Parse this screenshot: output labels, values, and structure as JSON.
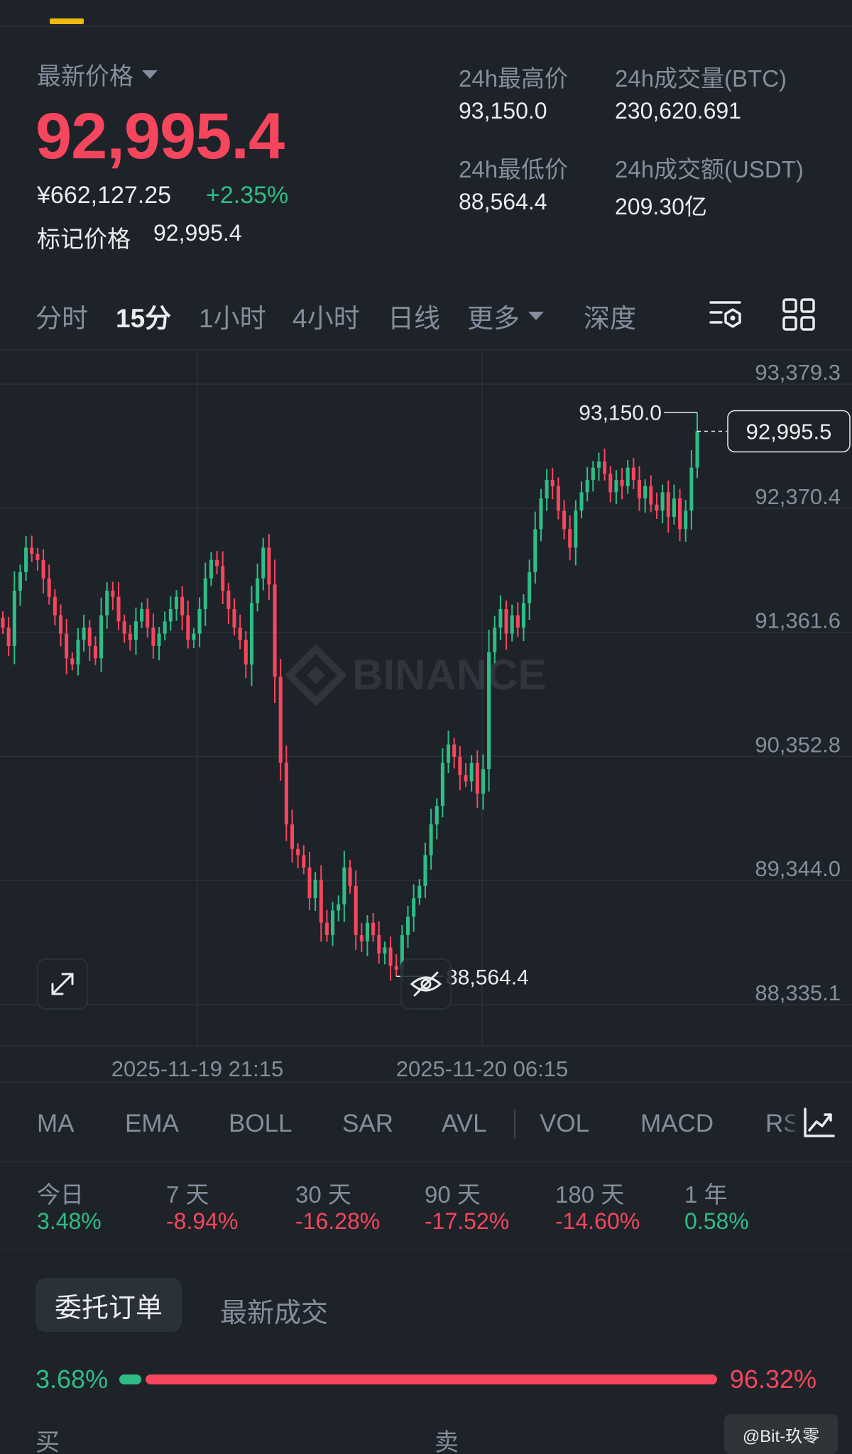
{
  "header": {
    "latest_label": "最新价格",
    "last_price": "92,995.4",
    "cny_price": "¥662,127.25",
    "change_pct": "+2.35%",
    "mark_label": "标记价格",
    "mark_value": "92,995.4"
  },
  "stats": {
    "high_label": "24h最高价",
    "high_value": "93,150.0",
    "low_label": "24h最低价",
    "low_value": "88,564.4",
    "vol_btc_label": "24h成交量(BTC)",
    "vol_btc_value": "230,620.691",
    "vol_usdt_label": "24h成交额(USDT)",
    "vol_usdt_value": "209.30亿"
  },
  "intervals": {
    "items": [
      "分时",
      "15分",
      "1小时",
      "4小时",
      "日线"
    ],
    "active": "15分",
    "more_label": "更多",
    "depth_label": "深度"
  },
  "chart": {
    "watermark": "BINANCE",
    "y_ticks": [
      "93,379.3",
      "92,370.4",
      "91,361.6",
      "90,352.8",
      "89,344.0",
      "88,335.1"
    ],
    "x_ticks": [
      "2025-11-19 21:15",
      "2025-11-20 06:15"
    ],
    "high_marker": "93,150.0",
    "low_marker": "88,564.4",
    "current_price_tag": "92,995.5",
    "up_color": "#2ebd85",
    "down_color": "#f6465d"
  },
  "chart_data": {
    "type": "candlestick",
    "interval": "15分",
    "y_ticks": [
      93379.3,
      92370.4,
      91361.6,
      90352.8,
      89344.0,
      88335.1
    ],
    "ylim": [
      88335.1,
      93379.3
    ],
    "x_ticks": [
      "2025-11-19 21:15",
      "2025-11-20 06:15"
    ],
    "high": 93150.0,
    "low": 88564.4,
    "last": 92995.5,
    "close_path": [
      91400,
      91250,
      91700,
      91850,
      92050,
      92000,
      91950,
      91800,
      91650,
      91500,
      91350,
      91150,
      91100,
      91300,
      91400,
      91250,
      91150,
      91500,
      91700,
      91650,
      91450,
      91350,
      91300,
      91450,
      91550,
      91400,
      91250,
      91350,
      91450,
      91550,
      91650,
      91500,
      91300,
      91350,
      91550,
      91800,
      91950,
      91900,
      91700,
      91550,
      91400,
      91300,
      91100,
      91600,
      91800,
      92050,
      91750,
      91000,
      90300,
      89800,
      89600,
      89550,
      89450,
      89200,
      89350,
      89000,
      88900,
      89100,
      89150,
      89450,
      89300,
      88900,
      88850,
      89000,
      88900,
      88750,
      88800,
      88650,
      88620,
      88900,
      89050,
      89200,
      89300,
      89550,
      89800,
      89950,
      90300,
      90450,
      90350,
      90200,
      90150,
      90300,
      90050,
      90250,
      91200,
      91400,
      91550,
      91350,
      91500,
      91400,
      91600,
      91850,
      92200,
      92450,
      92600,
      92550,
      92350,
      92200,
      92050,
      92350,
      92500,
      92600,
      92700,
      92750,
      92650,
      92500,
      92600,
      92550,
      92700,
      92600,
      92450,
      92550,
      92400,
      92350,
      92500,
      92300,
      92450,
      92200,
      92350,
      92700,
      92995.5
    ]
  },
  "indicators": {
    "items": [
      "MA",
      "EMA",
      "BOLL",
      "SAR",
      "AVL",
      "VOL",
      "MACD",
      "RSI"
    ]
  },
  "performance": {
    "items": [
      {
        "label": "今日",
        "value": "3.48%",
        "dir": "up"
      },
      {
        "label": "7 天",
        "value": "-8.94%",
        "dir": "down"
      },
      {
        "label": "30 天",
        "value": "-16.28%",
        "dir": "down"
      },
      {
        "label": "90 天",
        "value": "-17.52%",
        "dir": "down"
      },
      {
        "label": "180 天",
        "value": "-14.60%",
        "dir": "down"
      },
      {
        "label": "1 年",
        "value": "0.58%",
        "dir": "up"
      }
    ]
  },
  "orders": {
    "tab_orders": "委托订单",
    "tab_trades": "最新成交",
    "buy_pct": "3.68%",
    "sell_pct": "96.32%",
    "buy_ratio": 0.0368,
    "col_buy": "买",
    "col_sell": "卖"
  },
  "overlay": {
    "watermark_user": "@Bit-玖零"
  }
}
